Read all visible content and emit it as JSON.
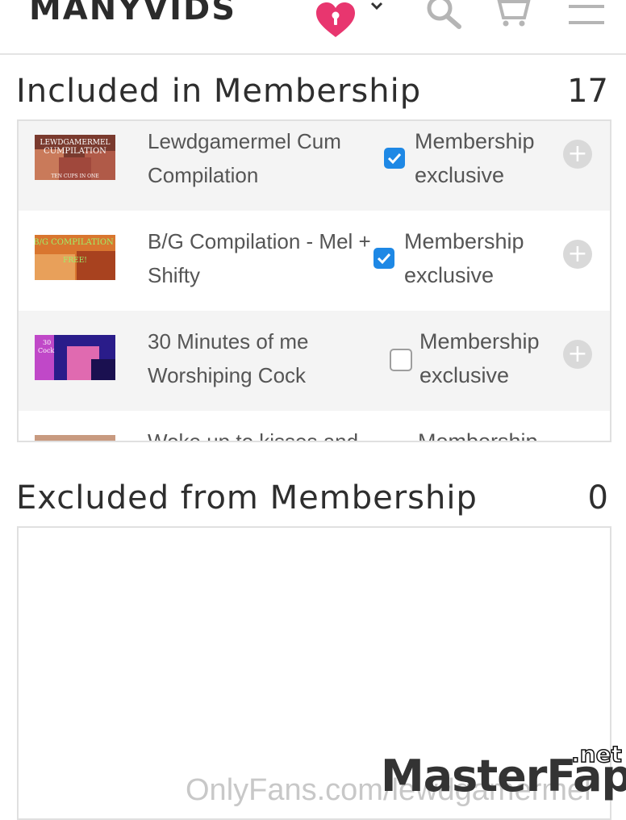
{
  "header": {
    "logo": "MANYVIDS",
    "icons": [
      "heart-lock-icon",
      "chevron-down-icon",
      "search-icon",
      "cart-icon",
      "menu-icon"
    ],
    "brand_pink": "#e8366f"
  },
  "included": {
    "title": "Included in Membership",
    "count": "17",
    "items": [
      {
        "title": "Lewdgamermel Cum Compilation",
        "thumb_text": [
          "LEWDGAMERMEL",
          "CUMPILATION",
          "TEN CUPS IN ONE"
        ],
        "checked": true,
        "badge": "Membership exclusive"
      },
      {
        "title": "B/G Compilation - Mel + Shifty",
        "thumb_text": [
          "B/G COMPILATION",
          "FREE!"
        ],
        "checked": true,
        "badge": "Membership exclusive"
      },
      {
        "title": "30 Minutes of me Worshiping Cock",
        "thumb_text": [
          "30",
          "Cock"
        ],
        "checked": false,
        "badge": "Membership exclusive"
      },
      {
        "title": "Woke up to kisses and",
        "thumb_text": [],
        "checked": false,
        "badge": "Membership"
      }
    ]
  },
  "excluded": {
    "title": "Excluded from Membership",
    "count": "0"
  },
  "watermarks": {
    "onlyfans": "OnlyFans.com/lewdgamermel",
    "masterfap": "MasterFap",
    "masterfap_tld": ".net"
  },
  "colors": {
    "check_blue": "#1e88e5",
    "row_shade": "#f4f4f4",
    "plus_grey": "#d9d9d9"
  }
}
